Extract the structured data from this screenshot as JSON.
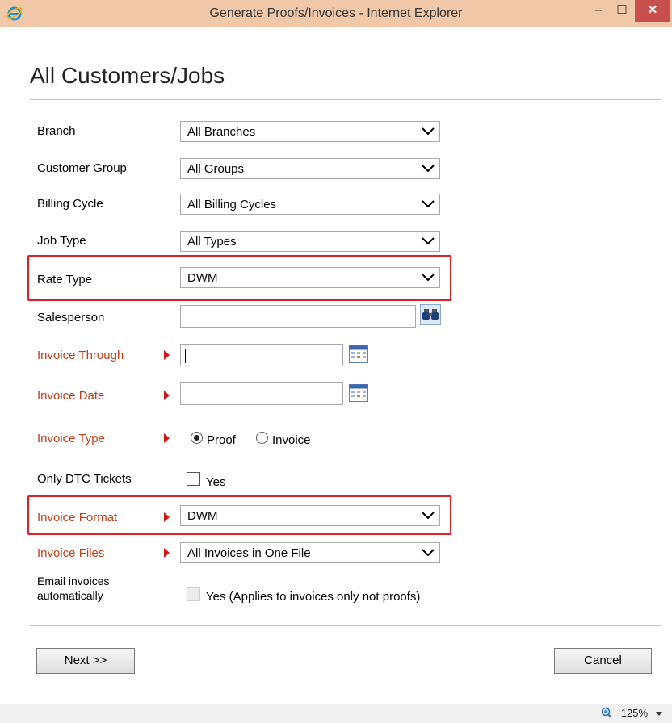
{
  "window": {
    "title": "Generate Proofs/Invoices - Internet Explorer",
    "minimize_glyph": "–",
    "maximize_glyph": "☐",
    "close_glyph": "✕"
  },
  "heading": "All Customers/Jobs",
  "form": {
    "branch": {
      "label": "Branch",
      "value": "All Branches"
    },
    "customer_group": {
      "label": "Customer Group",
      "value": "All Groups"
    },
    "billing_cycle": {
      "label": "Billing Cycle",
      "value": "All Billing Cycles"
    },
    "job_type": {
      "label": "Job Type",
      "value": "All Types"
    },
    "rate_type": {
      "label": "Rate Type",
      "value": "DWM"
    },
    "salesperson": {
      "label": "Salesperson",
      "value": ""
    },
    "invoice_through": {
      "label": "Invoice Through",
      "value": ""
    },
    "invoice_date": {
      "label": "Invoice Date",
      "value": ""
    },
    "invoice_type": {
      "label": "Invoice Type",
      "option_proof": "Proof",
      "option_invoice": "Invoice",
      "selected": "Proof"
    },
    "only_dtc": {
      "label": "Only DTC Tickets",
      "checkbox_label": "Yes",
      "checked": false
    },
    "invoice_format": {
      "label": "Invoice Format",
      "value": "DWM"
    },
    "invoice_files": {
      "label": "Invoice Files",
      "value": "All Invoices in One File"
    },
    "email_invoices": {
      "label_line1": "Email invoices",
      "label_line2": "automatically",
      "checkbox_label": "Yes (Applies to invoices only not proofs)",
      "checked": false,
      "disabled": true
    }
  },
  "buttons": {
    "next": "Next >>",
    "cancel": "Cancel"
  },
  "statusbar": {
    "zoom": "125%"
  },
  "colors": {
    "titlebar": "#f0c8a8",
    "close": "#c7504c",
    "required_label": "#c43c15",
    "highlight": "#d9222a"
  }
}
